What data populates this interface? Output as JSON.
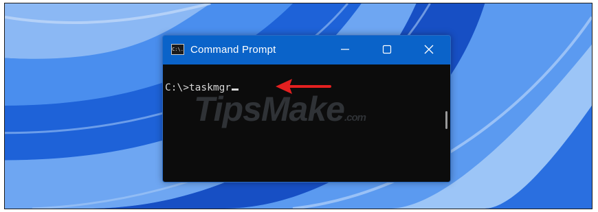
{
  "window": {
    "icon_text": "C:\\.",
    "title": "Command Prompt",
    "controls": {
      "minimize": "minimize-icon",
      "maximize": "maximize-icon",
      "close": "close-icon"
    }
  },
  "console": {
    "prompt": "C:\\>",
    "command": "taskmgr"
  },
  "watermark": {
    "main": "TipsMake",
    "suffix": ".com"
  },
  "colors": {
    "titlebar": "#0a63c9",
    "console_bg": "#0c0c0c",
    "console_text": "#d7d7d7",
    "arrow": "#e32020",
    "wallpaper": "#1d5fd6"
  }
}
